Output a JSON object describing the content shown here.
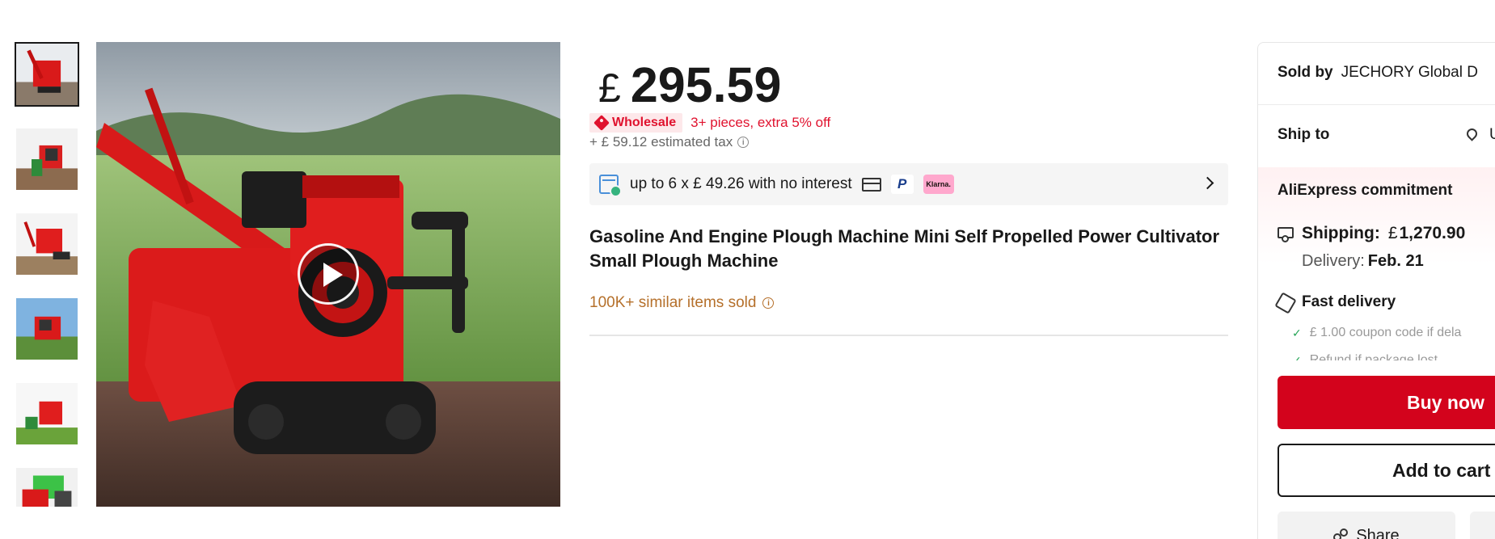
{
  "gallery": {
    "thumbnail_count": 6,
    "active_index": 0,
    "video_available": true
  },
  "product": {
    "currency_symbol": "£",
    "price": "295.59",
    "wholesale_badge": "Wholesale",
    "wholesale_offer": "3+ pieces, extra 5% off",
    "tax_text": "+ £ 59.12 estimated tax",
    "installment_text": "up to 6 x  £ 49.26 with no interest",
    "paypal_label": "P",
    "klarna_label": "Klarna.",
    "title": "Gasoline And Engine Plough Machine Mini Self Propelled Power Cultivator Small Plough Machine",
    "sold_text": "100K+ similar items sold",
    "info_glyph": "i"
  },
  "panel": {
    "sold_by_label": "Sold by",
    "seller_name": "JECHORY Global D",
    "ship_to_label": "Ship to",
    "ship_to_value": "U",
    "commitment_title": "AliExpress commitment",
    "shipping_label": "Shipping:",
    "shipping_currency": "£",
    "shipping_price": "1,270.90",
    "delivery_label": "Delivery:",
    "delivery_date": "Feb. 21",
    "fast_delivery_label": "Fast delivery",
    "perk_1": "£ 1.00 coupon code if dela",
    "perk_2": "Refund if package lost",
    "check_glyph": "✓",
    "buy_now": "Buy now",
    "add_to_cart": "Add to cart",
    "share": "Share"
  },
  "colors": {
    "brand_red": "#d3031c",
    "wholesale_red": "#e0122e",
    "sold_brown": "#b5702b"
  }
}
